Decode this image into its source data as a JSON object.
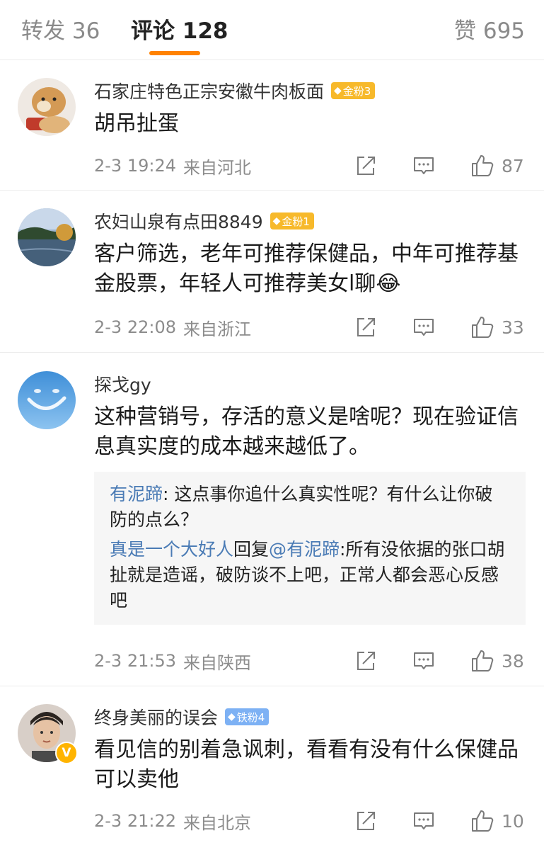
{
  "tabs": [
    {
      "label": "转发 36"
    },
    {
      "label": "评论 128"
    },
    {
      "label": "赞 695"
    }
  ],
  "comments": [
    {
      "username": "石家庄特色正宗安徽牛肉板面",
      "badge": "金粉3",
      "text": "胡吊扯蛋",
      "time": "2-3 19:24",
      "location": "来自河北",
      "likes": "87"
    },
    {
      "username": "农妇山泉有点田8849",
      "badge": "金粉1",
      "text": "客户筛选，老年可推荐保健品，中年可推荐基金股票，年轻人可推荐美女l聊",
      "emoji": "😂",
      "time": "2-3 22:08",
      "location": "来自浙江",
      "likes": "33"
    },
    {
      "username": "探戈gy",
      "text": "这种营销号，存活的意义是啥呢？现在验证信息真实度的成本越来越低了。",
      "replies": [
        {
          "name": "有泥蹄",
          "text": ": 这点事你追什么真实性呢？有什么让你破防的点么？"
        },
        {
          "name": "真是一个大好人",
          "mid": "回复",
          "to": "@有泥蹄",
          "text": ":所有没依据的张口胡扯就是造谣，破防谈不上吧，正常人都会恶心反感吧"
        }
      ],
      "time": "2-3 21:53",
      "location": "来自陕西",
      "likes": "38"
    },
    {
      "username": "终身美丽的误会",
      "badge": "铁粉4",
      "text": "看见信的别着急讽刺，看看有没有什么保健品可以卖他",
      "time": "2-3 21:22",
      "location": "来自北京",
      "likes": "10"
    }
  ],
  "colors": {
    "accent": "#ff8200",
    "link": "#4a7bb5",
    "gold_badge": "#f7b92b",
    "iron_badge": "#7db1f4"
  }
}
